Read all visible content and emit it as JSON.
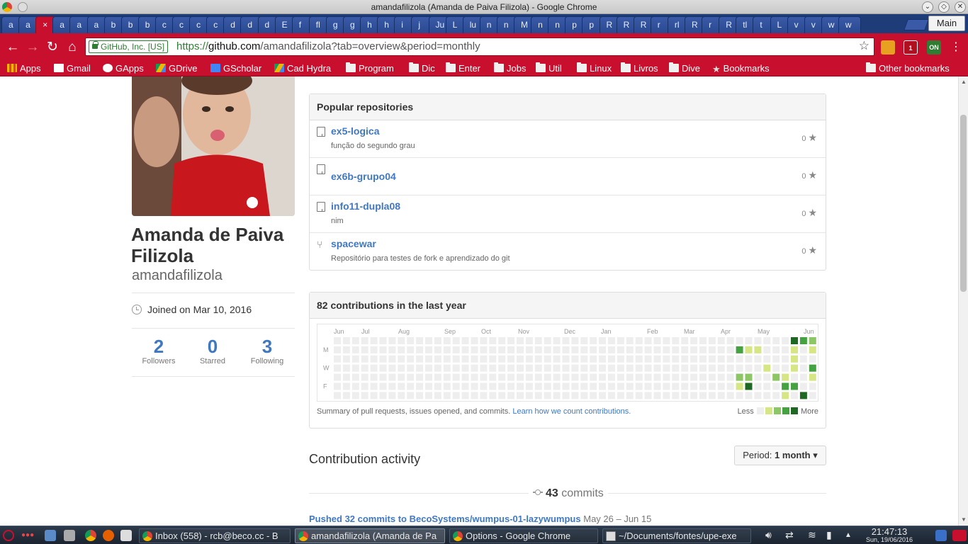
{
  "window": {
    "title": "amandafilizola (Amanda de Paiva Filizola) - Google Chrome"
  },
  "tabs": [
    "a",
    "a",
    "×",
    "a",
    "a",
    "a",
    "b",
    "b",
    "b",
    "c",
    "c",
    "c",
    "c",
    "d",
    "d",
    "d",
    "E",
    "f",
    "fl",
    "g",
    "g",
    "h",
    "h",
    "i",
    "j",
    "Ju",
    "L",
    "lu",
    "n",
    "n",
    "M",
    "n",
    "n",
    "p",
    "p",
    "R",
    "R",
    "R",
    "r",
    "rl",
    "R",
    "r",
    "R",
    "tl",
    "t",
    "L",
    "v",
    "v",
    "w",
    "w"
  ],
  "profile_label": "Main",
  "toolbar": {
    "back": "←",
    "forward": "→",
    "reload": "↻",
    "home": "⌂",
    "secure_label": "GitHub, Inc. [US]",
    "url_scheme": "https://",
    "url_host": "github.com",
    "url_path": "/amandafilizola?tab=overview&period=monthly",
    "bookmark_star": "☆",
    "ext_badge_1": "1",
    "ext_badge_2": "ON"
  },
  "bookmarks": [
    "Apps",
    "Gmail",
    "GApps",
    "GDrive",
    "GScholar",
    "Cad Hydra",
    "Program",
    "Dic",
    "Enter",
    "Jobs",
    "Util",
    "Linux",
    "Livros",
    "Dive",
    "Bookmarks"
  ],
  "other_bookmarks": "Other bookmarks",
  "profile": {
    "fullname": "Amanda de Paiva Filizola",
    "login": "amandafilizola",
    "joined": "Joined on Mar 10, 2016",
    "stats": [
      {
        "num": "2",
        "label": "Followers"
      },
      {
        "num": "0",
        "label": "Starred"
      },
      {
        "num": "3",
        "label": "Following"
      }
    ]
  },
  "popular": {
    "title": "Popular repositories",
    "repos": [
      {
        "name": "ex5-logica",
        "desc": "função do segundo grau",
        "stars": "0",
        "fork": false
      },
      {
        "name": "ex6b-grupo04",
        "desc": "",
        "stars": "0",
        "fork": false
      },
      {
        "name": "info11-dupla08",
        "desc": "nim",
        "stars": "0",
        "fork": false
      },
      {
        "name": "spacewar",
        "desc": "Repositório para testes de fork e aprendizado do git",
        "stars": "0",
        "fork": true
      }
    ]
  },
  "contributions": {
    "title": "82 contributions in the last year",
    "months": [
      "Jun",
      "Jul",
      "Aug",
      "Sep",
      "Oct",
      "Nov",
      "Dec",
      "Jan",
      "Feb",
      "Mar",
      "Apr",
      "May",
      "Jun"
    ],
    "weekdays": [
      "M",
      "W",
      "F"
    ],
    "summary": "Summary of pull requests, issues opened, and commits.",
    "learn_link": "Learn how we count contributions.",
    "less": "Less",
    "more": "More",
    "colors": [
      "#eeeeee",
      "#d6e685",
      "#8cc665",
      "#44a340",
      "#1e6823"
    ],
    "active_cells": [
      {
        "week": 44,
        "day": 1,
        "level": 3
      },
      {
        "week": 44,
        "day": 4,
        "level": 2
      },
      {
        "week": 44,
        "day": 5,
        "level": 1
      },
      {
        "week": 45,
        "day": 1,
        "level": 1
      },
      {
        "week": 45,
        "day": 4,
        "level": 2
      },
      {
        "week": 45,
        "day": 5,
        "level": 4
      },
      {
        "week": 46,
        "day": 1,
        "level": 1
      },
      {
        "week": 47,
        "day": 3,
        "level": 1
      },
      {
        "week": 48,
        "day": 4,
        "level": 2
      },
      {
        "week": 49,
        "day": 4,
        "level": 1
      },
      {
        "week": 49,
        "day": 5,
        "level": 3
      },
      {
        "week": 49,
        "day": 6,
        "level": 1
      },
      {
        "week": 50,
        "day": 0,
        "level": 4
      },
      {
        "week": 50,
        "day": 1,
        "level": 1
      },
      {
        "week": 50,
        "day": 2,
        "level": 1
      },
      {
        "week": 50,
        "day": 3,
        "level": 1
      },
      {
        "week": 50,
        "day": 5,
        "level": 3
      },
      {
        "week": 51,
        "day": 0,
        "level": 3
      },
      {
        "week": 51,
        "day": 6,
        "level": 4
      },
      {
        "week": 52,
        "day": 0,
        "level": 2
      },
      {
        "week": 52,
        "day": 1,
        "level": 1
      },
      {
        "week": 52,
        "day": 3,
        "level": 3
      },
      {
        "week": 52,
        "day": 4,
        "level": 1
      }
    ]
  },
  "activity": {
    "title": "Contribution activity",
    "period_label": "Period:",
    "period_value": "1 month",
    "commits_count": "43",
    "commits_word": "commits",
    "pushed": "Pushed 32 commits to BecoSystems/wumpus-01-lazywumpus",
    "pushed_range": "May 26 – Jun 15"
  },
  "taskbar": {
    "tasks": [
      {
        "label": "Inbox (558) - rcb@beco.cc - B",
        "active": false,
        "term": false
      },
      {
        "label": "amandafilizola (Amanda de Pa",
        "active": true,
        "term": false
      },
      {
        "label": "Options - Google Chrome",
        "active": false,
        "term": false
      },
      {
        "label": "~/Documents/fontes/upe-exe",
        "active": false,
        "term": true
      }
    ],
    "time": "21:47:13",
    "date": "Sun, 19/06/2016"
  }
}
